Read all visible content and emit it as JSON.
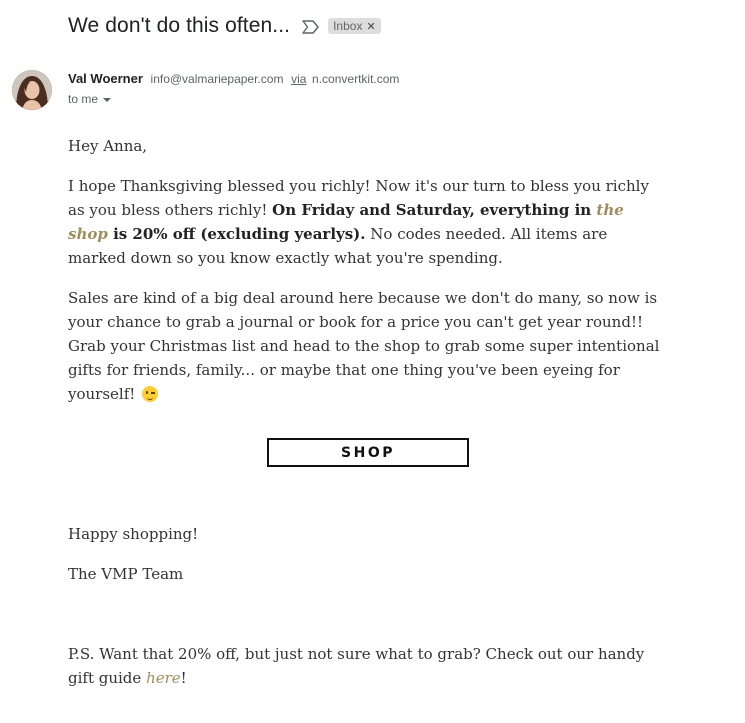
{
  "email": {
    "subject": "We don't do this often...",
    "label": "Inbox",
    "sender_name": "Val Woerner",
    "sender_email": "info@valmariepaper.com",
    "via_label": "via",
    "via_domain": "n.convertkit.com",
    "to": "to me"
  },
  "body": {
    "greeting": "Hey Anna,",
    "p1_a": "I hope Thanksgiving blessed you richly! Now it's our turn to bless you richly as you bless others richly! ",
    "p1_bold_a": "On Friday and Saturday, everything in ",
    "p1_link": "the shop",
    "p1_bold_b": " is 20% off (excluding yearlys).",
    "p1_b": " No codes needed. All items are marked down so you know exactly what you're spending.",
    "p2": "Sales are kind of a big deal around here because we don't do many, so now is your chance to grab a journal or book for a price you can't get year round!! Grab your Christmas list and head to the shop to grab some super intentional gifts for friends, family... or maybe that one thing you've been eyeing for yourself! ",
    "shop_button": "SHOP",
    "closing1": "Happy shopping!",
    "closing2": "The VMP Team",
    "ps_a": "P.S. Want that 20% off, but just not sure what to grab? Check out our handy gift guide ",
    "ps_link": "here",
    "ps_b": "!"
  },
  "icons": {
    "important": "label-important-icon",
    "emoji": "winking-face-emoji",
    "remove_label": "close-icon",
    "dropdown": "chevron-down-icon"
  },
  "colors": {
    "link_gold": "#a08d5c",
    "chip_bg": "#dddddd"
  }
}
